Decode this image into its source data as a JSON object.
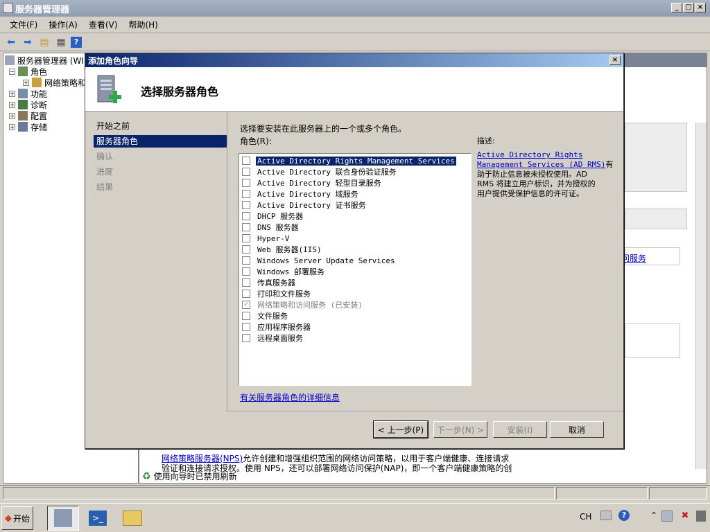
{
  "window": {
    "title": "服务器管理器"
  },
  "menu": [
    "文件(F)",
    "操作(A)",
    "查看(V)",
    "帮助(H)"
  ],
  "tree": {
    "root": "服务器管理器 (WI",
    "items": [
      {
        "label": "角色",
        "expanded": true
      },
      {
        "label": "网络策略和"
      },
      {
        "label": "功能"
      },
      {
        "label": "诊断"
      },
      {
        "label": "配置"
      },
      {
        "label": "存储"
      }
    ]
  },
  "background": {
    "side_link": "问服务",
    "bottom_link": "网络策略服务器(NPS)",
    "bottom_text1": "允许创建和增强组织范围的网络访问策略，以用于客户端健康、连接请求",
    "bottom_text2": "验证和连接请求授权。使用 NPS，还可以部署网络访问保护(NAP)，即一个客户端健康策略的创",
    "refresh_note": "使用向导时已禁用刷新"
  },
  "dialog": {
    "title": "添加角色向导",
    "heading": "选择服务器角色",
    "steps": [
      {
        "label": "开始之前",
        "state": "normal"
      },
      {
        "label": "服务器角色",
        "state": "active"
      },
      {
        "label": "确认",
        "state": "dim"
      },
      {
        "label": "进度",
        "state": "dim"
      },
      {
        "label": "结果",
        "state": "dim"
      }
    ],
    "instruction": "选择要安装在此服务器上的一个或多个角色。",
    "roles_label": "角色(R):",
    "roles": [
      {
        "label": "Active Directory Rights Management Services",
        "checked": false,
        "selected": true
      },
      {
        "label": "Active Directory 联合身份验证服务",
        "checked": false
      },
      {
        "label": "Active Directory 轻型目录服务",
        "checked": false
      },
      {
        "label": "Active Directory 域服务",
        "checked": false
      },
      {
        "label": "Active Directory 证书服务",
        "checked": false
      },
      {
        "label": "DHCP 服务器",
        "checked": false
      },
      {
        "label": "DNS 服务器",
        "checked": false
      },
      {
        "label": "Hyper-V",
        "checked": false
      },
      {
        "label": "Web 服务器(IIS)",
        "checked": false
      },
      {
        "label": "Windows Server Update Services",
        "checked": false
      },
      {
        "label": "Windows 部署服务",
        "checked": false
      },
      {
        "label": "传真服务器",
        "checked": false
      },
      {
        "label": "打印和文件服务",
        "checked": false
      },
      {
        "label": "网络策略和访问服务  (已安装)",
        "checked": true,
        "disabled": true
      },
      {
        "label": "文件服务",
        "checked": false
      },
      {
        "label": "应用程序服务器",
        "checked": false
      },
      {
        "label": "远程桌面服务",
        "checked": false
      }
    ],
    "more_info_link": "有关服务器角色的详细信息",
    "description_label": "描述:",
    "description_link1": "Active Directory Rights",
    "description_link2": "Management Services (AD RMS)",
    "description_link_suffix": "有",
    "description_text": [
      "助于防止信息被未授权使用。AD",
      "RMS 将建立用户标识，并为授权的",
      "用户提供受保护信息的许可证。"
    ],
    "buttons": {
      "prev": "< 上一步(P)",
      "next": "下一步(N) >",
      "install": "安装(I)",
      "cancel": "取消"
    }
  },
  "taskbar": {
    "start": "开始",
    "lang": "CH"
  }
}
